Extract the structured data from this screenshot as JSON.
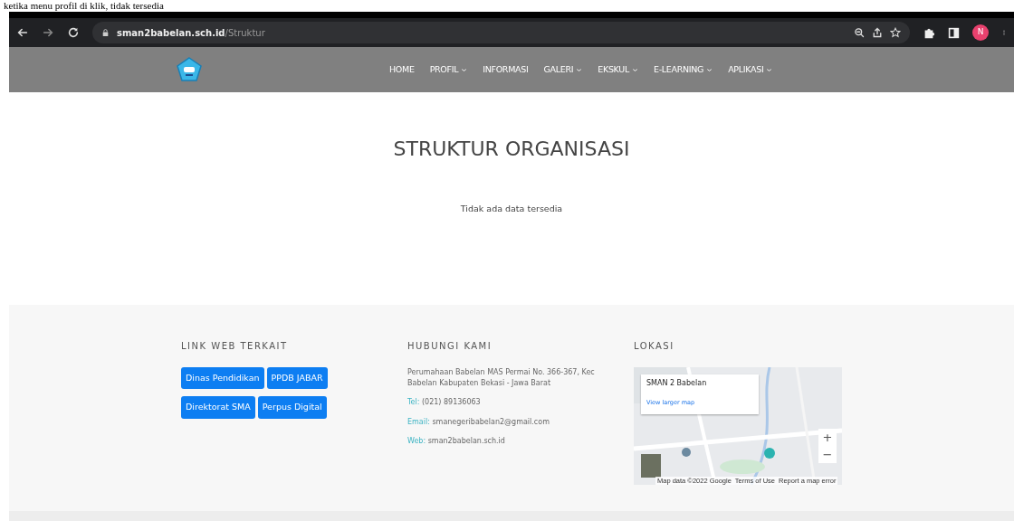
{
  "caption": "ketika menu profil di klik, tidak tersedia",
  "browser": {
    "url_host": "sman2babelan.sch.id",
    "url_path": "/Struktur",
    "profile_initial": "N"
  },
  "nav": [
    {
      "label": "HOME",
      "dropdown": false
    },
    {
      "label": "PROFIL",
      "dropdown": true
    },
    {
      "label": "INFORMASI",
      "dropdown": false
    },
    {
      "label": "GALERI",
      "dropdown": true
    },
    {
      "label": "EKSKUL",
      "dropdown": true
    },
    {
      "label": "E-LEARNING",
      "dropdown": true
    },
    {
      "label": "APLIKASI",
      "dropdown": true
    }
  ],
  "page": {
    "title": "STRUKTUR ORGANISASI",
    "message": "Tidak ada data tersedia"
  },
  "footer": {
    "links_title": "LINK WEB TERKAIT",
    "links": [
      [
        "Dinas Pendidikan",
        "PPDB JABAR"
      ],
      [
        "Direktorat SMA",
        "Perpus Digital"
      ]
    ],
    "contact_title": "HUBUNGI KAMI",
    "contact": [
      {
        "value": "Perumahaan Babelan MAS Permai No. 366-367, Kec Babelan Kabupaten Bekasi - Jawa Barat"
      },
      {
        "label": "Tel:",
        "value": "(021) 89136063"
      },
      {
        "label": "Email:",
        "value": "smanegeribabelan2@gmail.com"
      },
      {
        "label": "Web:",
        "value": "sman2babelan.sch.id"
      }
    ],
    "location_title": "LOKASI",
    "map": {
      "place": "SMAN 2 Babelan",
      "larger_link": "View larger map",
      "zoom_in": "+",
      "zoom_out": "−",
      "attribution": "Map data ©2022 Google",
      "terms": "Terms of Use",
      "report": "Report a map error"
    }
  }
}
